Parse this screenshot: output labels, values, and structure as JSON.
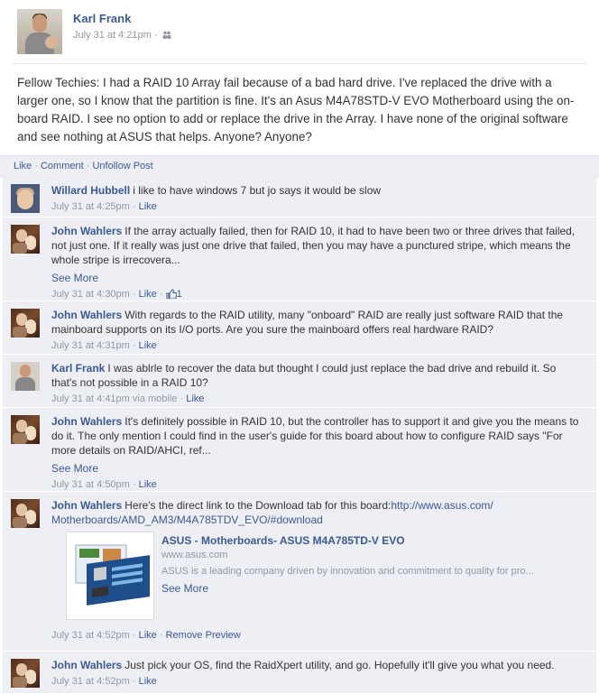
{
  "post": {
    "author": "Karl Frank",
    "time": "July 31 at 4:21pm",
    "meta_separator": "·",
    "body": "Fellow Techies: I had a RAID 10 Array fail because of a bad hard drive. I've replaced the drive with a larger one, so I know that the partition is fine. It's an Asus M4A78STD-V EVO Motherboard using the on-board RAID. I see no option to add or replace the drive in the Array. I have none of the original software and see nothing at ASUS that helps. Anyone? Anyone?"
  },
  "actions": {
    "like": "Like",
    "comment": "Comment",
    "unfollow": "Unfollow Post",
    "separator": "·"
  },
  "comments": [
    {
      "author": "Willard Hubbell",
      "text": "i like to have windows 7 but jo says it would be slow",
      "time": "July 31 at 4:25pm",
      "like": "Like"
    },
    {
      "author": "John Wahlers",
      "text": "If the array actually failed, then for RAID 10, it had to have been two or three drives that failed, not just one. If it really was just one drive that failed, then you may have a punctured stripe, which means the whole stripe is irrecovera...",
      "see_more": "See More",
      "time": "July 31 at 4:30pm",
      "like": "Like",
      "like_count": "1"
    },
    {
      "author": "John Wahlers",
      "text": "With regards to the RAID utility, many \"onboard\" RAID are really just software RAID that the mainboard supports on its I/O ports. Are you sure the mainboard offers real hardware RAID?",
      "time": "July 31 at 4:31pm",
      "like": "Like"
    },
    {
      "author": "Karl Frank",
      "text": "I was ablrle to recover the data but thought I could just replace the bad drive and rebuild it. So that's not possible in a RAID 10?",
      "time": "July 31 at 4:41pm via mobile",
      "like": "Like"
    },
    {
      "author": "John Wahlers",
      "text": "It's definitely possible in RAID 10, but the controller has to support it and give you the means to do it. The only mention I could find in the user's guide for this board about how to configure RAID says \"For more details on RAID/AHCI, ref...",
      "see_more": "See More",
      "time": "July 31 at 4:50pm",
      "like": "Like"
    },
    {
      "author": "John Wahlers",
      "text": "Here's the direct link to the Download tab for this board:",
      "link": "http://www.asus.com/ Motherboards/AMD_AM3/M4A785TDV_EVO/#download",
      "time": "July 31 at 4:52pm",
      "like": "Like",
      "remove_preview": "Remove Preview",
      "preview": {
        "title": "ASUS - Motherboards- ASUS M4A785TD-V EVO",
        "site": "www.asus.com",
        "description": "ASUS is a leading company driven by innovation and commitment to quality for pro...",
        "see_more": "See More"
      }
    },
    {
      "author": "John Wahlers",
      "text": "Just pick your OS, find the RaidXpert utility, and go. Hopefully it'll give you what you need.",
      "time": "July 31 at 4:52pm",
      "like": "Like"
    }
  ],
  "colors": {
    "link": "#3b5998",
    "meta": "#9197a3",
    "comment_bg": "#edeff4"
  }
}
